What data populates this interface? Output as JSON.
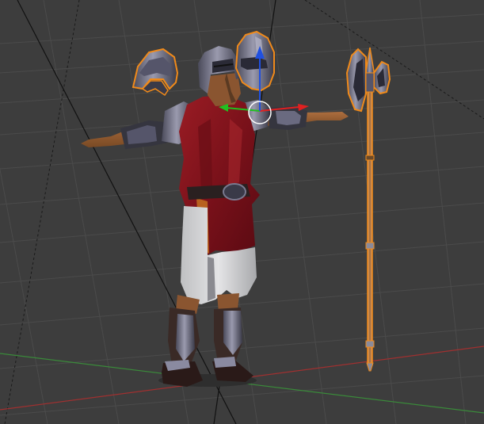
{
  "viewport": {
    "background": "#3d3d3d",
    "grid_color": "#4a4a4a",
    "x_axis_color": "#a03030",
    "y_axis_color": "#3a8a3a",
    "selection_outline_color": "#f08a1a",
    "gizmo": {
      "x_axis_color": "#e02020",
      "y_axis_color": "#20c020",
      "z_axis_color": "#2050e0",
      "ring_color": "#ffffff"
    },
    "objects": [
      {
        "name": "soldier",
        "selected": false
      },
      {
        "name": "kettle-helmet",
        "selected": true
      },
      {
        "name": "visored-helmet",
        "selected": false
      },
      {
        "name": "sallet-helmet",
        "selected": true
      },
      {
        "name": "halberd",
        "selected": true
      }
    ]
  }
}
